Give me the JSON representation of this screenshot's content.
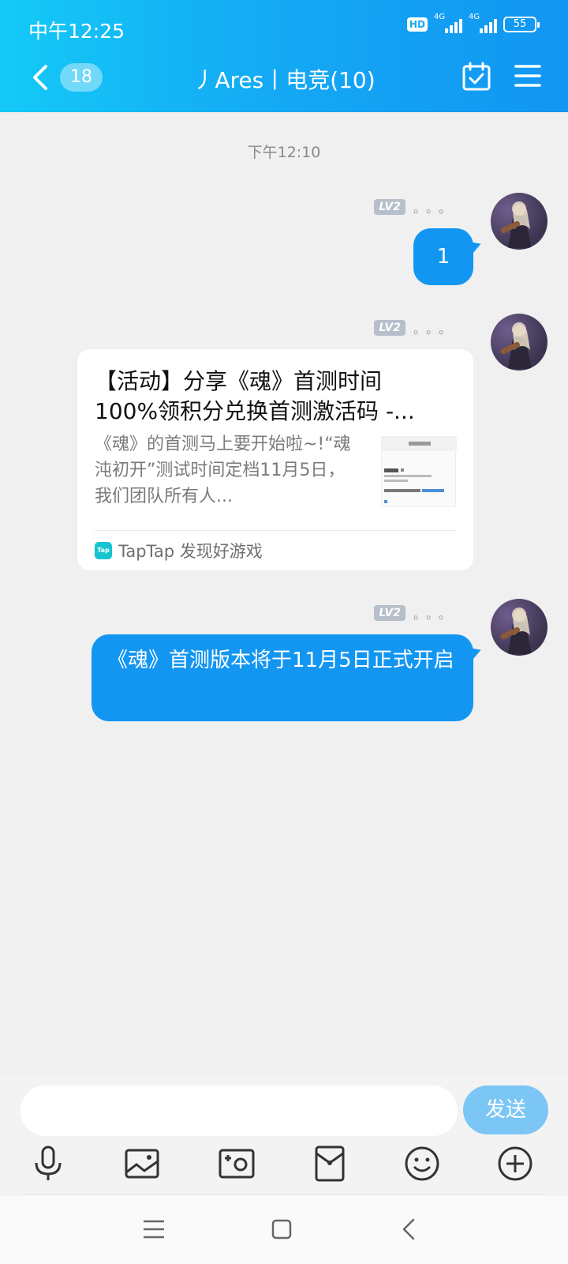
{
  "status": {
    "time": "中午12:25",
    "hd": "HD",
    "net1": "4G",
    "net2": "4G",
    "battery": "55"
  },
  "header": {
    "unread_badge": "18",
    "title": "丿Ares丨电竞(10)"
  },
  "chat": {
    "timestamp": "下午12:10",
    "messages": [
      {
        "type": "text",
        "level": "LV2",
        "text": "1"
      },
      {
        "type": "share_card",
        "level": "LV2",
        "title": "【活动】分享《魂》首测时间100%领积分兑换首测激活码 -...",
        "description": "《魂》的首测马上要开始啦~!“魂沌初开”测试时间定档11月5日，我们团队所有人...",
        "source": "TapTap 发现好游戏",
        "source_icon": "Tap"
      },
      {
        "type": "text",
        "level": "LV2",
        "text": "《魂》首测版本将于11月5日正式开启"
      }
    ]
  },
  "input": {
    "placeholder": "",
    "send_label": "发送"
  },
  "colors": {
    "header": "#14a8f4",
    "bubble": "#1296f2",
    "send": "#7cc6f5",
    "background": "#f0f0f0"
  }
}
